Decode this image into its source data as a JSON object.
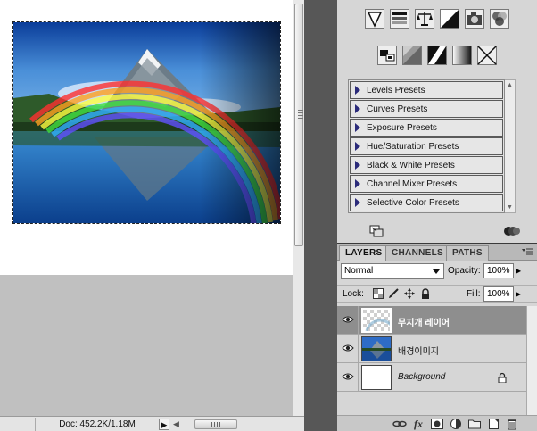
{
  "status": {
    "doc_info": "Doc: 452.2K/1.18M",
    "arrow_glyph": "▶",
    "scroll_left_glyph": "◀"
  },
  "adjustments": {
    "presets": [
      {
        "label": "Levels Presets"
      },
      {
        "label": "Curves Presets"
      },
      {
        "label": "Exposure Presets"
      },
      {
        "label": "Hue/Saturation Presets"
      },
      {
        "label": "Black & White Presets"
      },
      {
        "label": "Channel Mixer Presets"
      },
      {
        "label": "Selective Color Presets"
      }
    ],
    "row1_icons": [
      "vibrance-triangle-icon",
      "gradient-levels-icon",
      "color-balance-scale-icon",
      "black-white-icon",
      "photo-filter-icon",
      "channel-mixer-icon"
    ],
    "row2_icons": [
      "invert-icon",
      "posterize-icon",
      "threshold-icon",
      "gradient-map-icon",
      "selective-color-icon"
    ],
    "scroll_up_glyph": "▲",
    "scroll_down_glyph": "▼"
  },
  "layers_panel": {
    "tabs": [
      {
        "label": "LAYERS",
        "active": true
      },
      {
        "label": "CHANNELS",
        "active": false
      },
      {
        "label": "PATHS",
        "active": false
      }
    ],
    "blend_mode": "Normal",
    "opacity_label": "Opacity:",
    "opacity_value": "100%",
    "lock_label": "Lock:",
    "fill_label": "Fill:",
    "fill_value": "100%",
    "spin_glyph": "▶",
    "layers": [
      {
        "name": "무지개 레이어",
        "selected": true,
        "thumbnail": "transparent"
      },
      {
        "name": "배경이미지",
        "selected": false,
        "thumbnail": "landscape"
      },
      {
        "name": "Background",
        "selected": false,
        "thumbnail": "white",
        "locked": true
      }
    ],
    "footer_icons": [
      "link-icon",
      "fx-icon",
      "mask-icon",
      "adjustment-layer-icon",
      "group-folder-icon",
      "new-layer-icon",
      "trash-icon"
    ],
    "fx_glyph": "fx"
  },
  "colors": {
    "workspace_bg": "#535353",
    "panel_bg": "#d6d6d6",
    "selected_layer": "#8e8e8e",
    "preset_arrow": "#2b2b7a"
  }
}
